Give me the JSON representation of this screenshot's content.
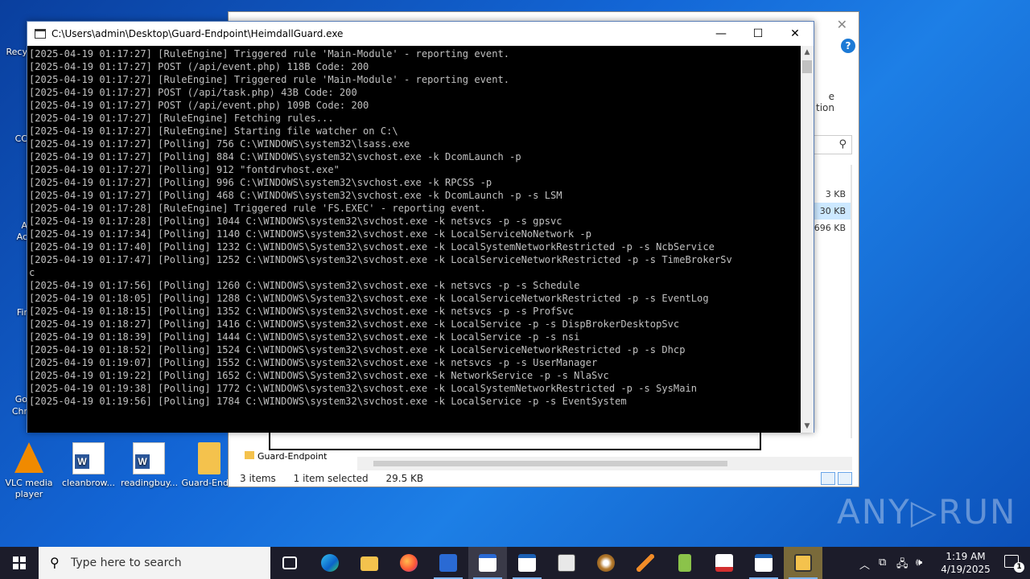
{
  "desktop": {
    "icons": [
      {
        "label": "VLC media player"
      },
      {
        "label": "cleanbrow..."
      },
      {
        "label": "readingbuy..."
      },
      {
        "label": "Guard-End..."
      }
    ],
    "partial_labels": [
      "Recy",
      "CC",
      "A",
      "Ac",
      "Fir",
      "Go",
      "Chr"
    ]
  },
  "explorer": {
    "ribbon_fragment": "e",
    "ribbon_fragment2": "tion",
    "sizes": [
      "3 KB",
      "30 KB",
      "696 KB"
    ],
    "nav_item": "Guard-Endpoint",
    "status": {
      "items": "3 items",
      "selected": "1 item selected",
      "size": "29.5 KB"
    }
  },
  "console": {
    "title": "C:\\Users\\admin\\Desktop\\Guard-Endpoint\\HeimdallGuard.exe",
    "lines": [
      "[2025-04-19 01:17:27] [RuleEngine] Triggered rule 'Main-Module' - reporting event.",
      "[2025-04-19 01:17:27] POST (/api/event.php) 118B Code: 200",
      "[2025-04-19 01:17:27] [RuleEngine] Triggered rule 'Main-Module' - reporting event.",
      "[2025-04-19 01:17:27] POST (/api/task.php) 43B Code: 200",
      "[2025-04-19 01:17:27] POST (/api/event.php) 109B Code: 200",
      "[2025-04-19 01:17:27] [RuleEngine] Fetching rules...",
      "[2025-04-19 01:17:27] [RuleEngine] Starting file watcher on C:\\",
      "[2025-04-19 01:17:27] [Polling] 756 C:\\WINDOWS\\system32\\lsass.exe",
      "[2025-04-19 01:17:27] [Polling] 884 C:\\WINDOWS\\system32\\svchost.exe -k DcomLaunch -p",
      "[2025-04-19 01:17:27] [Polling] 912 \"fontdrvhost.exe\"",
      "[2025-04-19 01:17:27] [Polling] 996 C:\\WINDOWS\\system32\\svchost.exe -k RPCSS -p",
      "[2025-04-19 01:17:27] [Polling] 468 C:\\WINDOWS\\system32\\svchost.exe -k DcomLaunch -p -s LSM",
      "[2025-04-19 01:17:28] [RuleEngine] Triggered rule 'FS.EXEC' - reporting event.",
      "[2025-04-19 01:17:28] [Polling] 1044 C:\\WINDOWS\\system32\\svchost.exe -k netsvcs -p -s gpsvc",
      "[2025-04-19 01:17:34] [Polling] 1140 C:\\WINDOWS\\system32\\svchost.exe -k LocalServiceNoNetwork -p",
      "[2025-04-19 01:17:40] [Polling] 1232 C:\\WINDOWS\\System32\\svchost.exe -k LocalSystemNetworkRestricted -p -s NcbService",
      "[2025-04-19 01:17:47] [Polling] 1252 C:\\WINDOWS\\system32\\svchost.exe -k LocalServiceNetworkRestricted -p -s TimeBrokerSv",
      "c",
      "[2025-04-19 01:17:56] [Polling] 1260 C:\\WINDOWS\\system32\\svchost.exe -k netsvcs -p -s Schedule",
      "[2025-04-19 01:18:05] [Polling] 1288 C:\\WINDOWS\\System32\\svchost.exe -k LocalServiceNetworkRestricted -p -s EventLog",
      "[2025-04-19 01:18:15] [Polling] 1352 C:\\WINDOWS\\system32\\svchost.exe -k netsvcs -p -s ProfSvc",
      "[2025-04-19 01:18:27] [Polling] 1416 C:\\WINDOWS\\system32\\svchost.exe -k LocalService -p -s DispBrokerDesktopSvc",
      "[2025-04-19 01:18:39] [Polling] 1444 C:\\WINDOWS\\system32\\svchost.exe -k LocalService -p -s nsi",
      "[2025-04-19 01:18:52] [Polling] 1524 C:\\WINDOWS\\system32\\svchost.exe -k LocalServiceNetworkRestricted -p -s Dhcp",
      "[2025-04-19 01:19:07] [Polling] 1552 C:\\WINDOWS\\system32\\svchost.exe -k netsvcs -p -s UserManager",
      "[2025-04-19 01:19:22] [Polling] 1652 C:\\WINDOWS\\System32\\svchost.exe -k NetworkService -p -s NlaSvc",
      "[2025-04-19 01:19:38] [Polling] 1772 C:\\WINDOWS\\system32\\svchost.exe -k LocalSystemNetworkRestricted -p -s SysMain",
      "[2025-04-19 01:19:56] [Polling] 1784 C:\\WINDOWS\\system32\\svchost.exe -k LocalService -p -s EventSystem"
    ],
    "buttons": {
      "minimize": "—",
      "maximize": "☐",
      "close": "✕"
    }
  },
  "watermark": "ANY▷RUN",
  "taskbar": {
    "search_placeholder": "Type here to search",
    "clock_time": "1:19 AM",
    "clock_date": "4/19/2025",
    "notification_count": "1",
    "icons": [
      "task-view",
      "edge",
      "file-explorer",
      "firefox",
      "app-blue",
      "console",
      "explorer-window",
      "far-manager",
      "app-circle",
      "app-pen",
      "app-green",
      "app-red",
      "app-window",
      "app-folder-active"
    ]
  }
}
